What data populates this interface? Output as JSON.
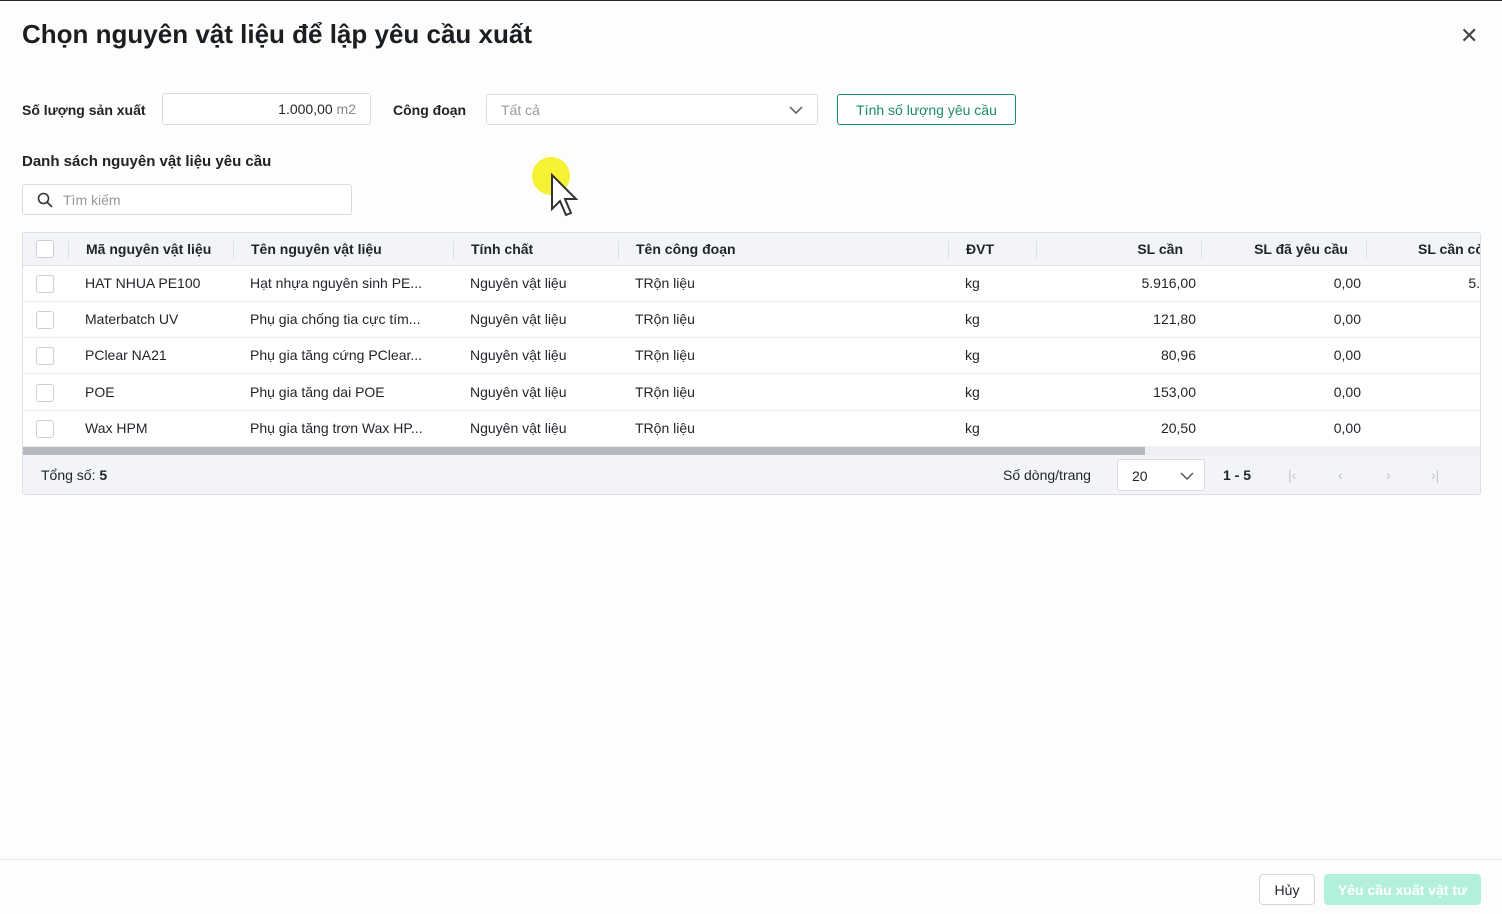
{
  "dialog": {
    "title": "Chọn nguyên vật liệu để lập yêu cầu xuất",
    "close_icon": "close-icon"
  },
  "form": {
    "quantity_label": "Số lượng sản xuất",
    "quantity_value": "1.000,00",
    "quantity_unit": "m2",
    "stage_label": "Công đoạn",
    "stage_value": "Tất cả",
    "calc_button": "Tính số lượng yêu cầu"
  },
  "list": {
    "title": "Danh sách nguyên vật liệu yêu cầu",
    "search_placeholder": "Tìm kiếm"
  },
  "table": {
    "columns": [
      "Mã nguyên vật liệu",
      "Tên nguyên vật liệu",
      "Tính chất",
      "Tên công đoạn",
      "ĐVT",
      "SL cần",
      "SL đã yêu cầu",
      "SL cần cò"
    ],
    "rows": [
      {
        "code": "HAT NHUA PE100",
        "name": "Hạt nhựa nguyên sinh PE...",
        "type": "Nguyên vật liệu",
        "stage": "TRộn liệu",
        "unit": "kg",
        "need": "5.916,00",
        "requested": "0,00",
        "remaining": "5."
      },
      {
        "code": "Materbatch UV",
        "name": "Phụ gia chống tia cực tím...",
        "type": "Nguyên vật liệu",
        "stage": "TRộn liệu",
        "unit": "kg",
        "need": "121,80",
        "requested": "0,00",
        "remaining": ""
      },
      {
        "code": "PClear NA21",
        "name": "Phụ gia tăng cứng PClear...",
        "type": "Nguyên vật liệu",
        "stage": "TRộn liệu",
        "unit": "kg",
        "need": "80,96",
        "requested": "0,00",
        "remaining": ""
      },
      {
        "code": "POE",
        "name": "Phụ gia tăng dai POE",
        "type": "Nguyên vật liệu",
        "stage": "TRộn liệu",
        "unit": "kg",
        "need": "153,00",
        "requested": "0,00",
        "remaining": ""
      },
      {
        "code": "Wax HPM",
        "name": "Phụ gia tăng trơn Wax HP...",
        "type": "Nguyên vật liệu",
        "stage": "TRộn liệu",
        "unit": "kg",
        "need": "20,50",
        "requested": "0,00",
        "remaining": ""
      }
    ],
    "footer": {
      "total_label": "Tổng số:",
      "total": "5",
      "rows_per_page_label": "Số dòng/trang",
      "rows_per_page": "20",
      "range": "1 - 5"
    }
  },
  "actions": {
    "cancel": "Hủy",
    "submit": "Yêu cầu xuất vật tư"
  },
  "colors": {
    "accent": "#1b8a6b",
    "submit_disabled": "#b3f0dc"
  }
}
